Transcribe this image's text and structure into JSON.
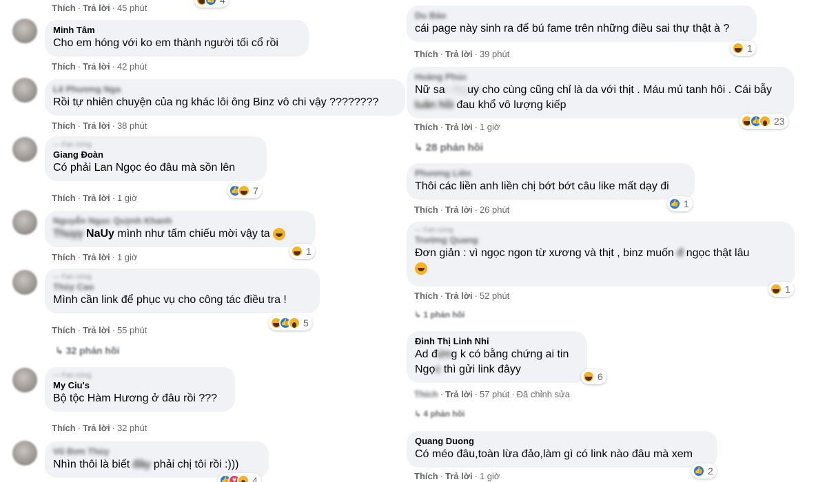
{
  "actions": {
    "like": "Thích",
    "reply": "Trả lời",
    "edited": "Đã chỉnh sửa"
  },
  "left": [
    {
      "id": "c0",
      "time": "45 phút",
      "count": "4"
    },
    {
      "id": "c1",
      "author": "Minh Tâm",
      "lines": [
        "Cho em hóng với ko em thành người tối cổ rồi"
      ],
      "time": "42 phút"
    },
    {
      "id": "c2",
      "author": "Lê Phương Nga",
      "lines": [
        "Rồi tự nhiên chuyện của ng khác lôi ông Binz vô chi vậy ????????"
      ],
      "time": "38 phút"
    },
    {
      "id": "c3",
      "author": "Giang Đoàn",
      "lines": [
        "Có phải Lan Ngọc éo đâu mà sồn lên"
      ],
      "time": "1 giờ",
      "count": "7"
    },
    {
      "id": "c4",
      "author": "Nguyễn Ngọc Quỳnh Khanh",
      "mention_prefix": "Thuyy",
      "mention": "NaUy",
      "text_after": "mình như tấm chiếu mời vậy ta",
      "time": "1 giờ",
      "count": "1"
    },
    {
      "id": "c5",
      "author": "Thùy Cao",
      "lines": [
        "Mình cần link để phục vụ cho công tác điều tra !"
      ],
      "time": "55 phút",
      "count": "5",
      "replies": "32 phản hồi"
    },
    {
      "id": "c6",
      "author": "My Ciu's",
      "lines": [
        "Bộ tộc Hàm Hương ở đâu rồi ???"
      ],
      "time": "32 phút"
    },
    {
      "id": "c7",
      "author": "Vũ Đơn Thùy",
      "line_start": "Nhìn thôi là biết",
      "line_blur": "đây",
      "line_end": "phải chị tôi rồi :)))",
      "count": "4"
    }
  ],
  "right": [
    {
      "id": "r1",
      "author": "Du Bảo",
      "lines": [
        "cái page này sinh ra để bú fame trên những điều sai thự thật à ?"
      ],
      "time": "39 phút",
      "count": "1"
    },
    {
      "id": "r2",
      "author": "Hoàng Phúc",
      "line1_start": "Nữ sa",
      "line1_blur": "c đẹp d",
      "line1_end": "uy cho cùng cũng chỉ là da với thịt . Máu mủ tanh hôi . Cái bẫy",
      "line2_blur": "luân hồi",
      "line2_end": "đau khổ vô lượng kiếp",
      "time": "1 giờ",
      "count": "23",
      "replies": "28 phản hồi"
    },
    {
      "id": "r3",
      "author": "Phương Liên",
      "lines": [
        "Thôi các liền anh liền chị bớt bớt câu like mất dạy đi"
      ],
      "time": "26 phút",
      "count": "1"
    },
    {
      "id": "r4",
      "author": "Trường Quang",
      "line_start": "Đơn giản : vì ngọc ngon từ xương và thịt , binz muốn",
      "line_blur": "đ",
      "line_end": "ngọc thật lâu",
      "time": "52 phút",
      "count": "1",
      "replies": "1 phản hồi"
    },
    {
      "id": "r5",
      "author": "Đinh Thị Linh Nhi",
      "line1_start": "Ad đ",
      "line1_blur": "ứn",
      "line1_end": "g k có bằng chứng ai tin",
      "line2_start": "Ngọ",
      "line2_blur": "c",
      "line2_end": "thì gửi link đâyy",
      "time": "57 phút",
      "count": "6",
      "replies": "4 phản hồi"
    },
    {
      "id": "r6",
      "author": "Quang Duong",
      "lines": [
        "Có méo đâu,toàn lừa đảo,làm gì có link nào đâu mà xem"
      ],
      "time": "1 giờ",
      "count": "2"
    }
  ]
}
